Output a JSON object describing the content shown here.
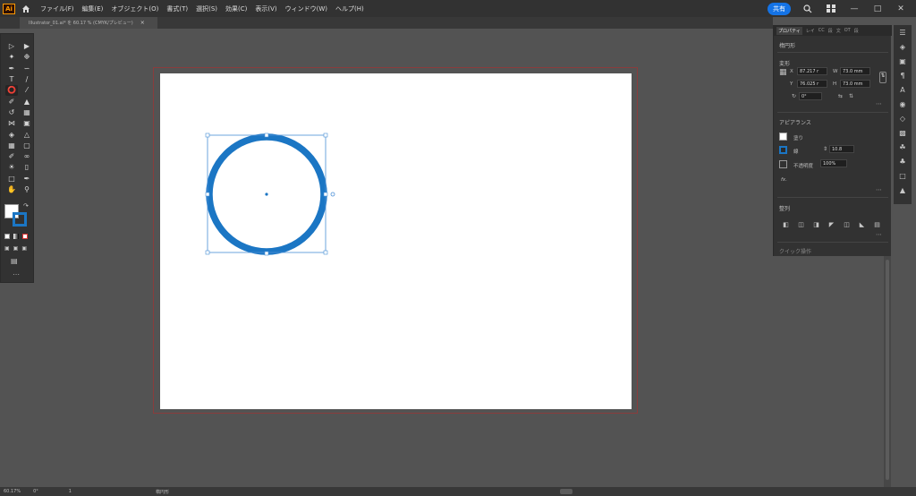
{
  "app": {
    "logo": "Ai"
  },
  "menubar": {
    "items": [
      "ファイル(F)",
      "編集(E)",
      "オブジェクト(O)",
      "書式(T)",
      "選択(S)",
      "効果(C)",
      "表示(V)",
      "ウィンドウ(W)",
      "ヘルプ(H)"
    ],
    "share_label": "共有"
  },
  "document_tab": {
    "title": "Illustrator_01.ai* を 60.17 % (CMYK/プレビュー)",
    "close": "×"
  },
  "properties_panel": {
    "tabs": [
      "プロパティ",
      "レイ",
      "CC",
      "段",
      "文",
      "OT",
      "段"
    ],
    "section_object": "楕円形",
    "section_transform": "変形",
    "x_label": "X",
    "x_value": "87.217 r",
    "y_label": "Y",
    "y_value": "76.025 r",
    "w_label": "W",
    "w_value": "73.0 mm",
    "h_label": "H",
    "h_value": "73.0 mm",
    "rotate_value": "0°",
    "section_appearance": "アピアランス",
    "fill_label": "塗り",
    "stroke_label": "線",
    "stroke_value": "10.8",
    "opacity_label": "不透明度",
    "opacity_value": "100%",
    "fx_label": "fx.",
    "section_align": "整列",
    "section_quick": "クイック操作"
  },
  "statusbar": {
    "zoom": "60.17%",
    "angle": "0°",
    "artboard": "1",
    "tool": "楕円形"
  },
  "colors": {
    "stroke": "#1b76c4",
    "accent": "#1473e6",
    "artboard_border": "#8a3c3c"
  },
  "canvas": {
    "shape": "circle",
    "selected": true
  }
}
